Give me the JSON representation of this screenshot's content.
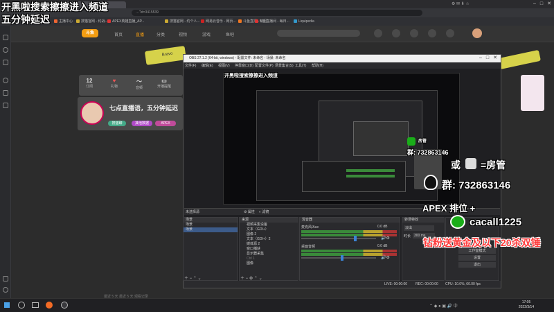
{
  "browser": {
    "tab_title": "直播...",
    "url": "…?d=3415539",
    "bookmarks": [
      "主播中心",
      "搜猫官网 - 约战...",
      "APEX英雄直播_AP...",
      "搜猫官网 - 约个人...",
      "网易云音乐 - 网页...",
      "斗鱼直播 - 热门...",
      "5 鱼直播间 - 每日...",
      "Liquipedia"
    ]
  },
  "site": {
    "nav_items": [
      "首页",
      "直播",
      "分类",
      "视频",
      "游戏",
      "鱼吧"
    ],
    "stats": [
      {
        "value": "12",
        "label": "订阅"
      },
      {
        "value": "",
        "label": "礼物"
      },
      {
        "value": "",
        "label": "音频"
      },
      {
        "value": "",
        "label": "开播提醒"
      }
    ],
    "stream_title": "七点直播语，五分钟延迟",
    "stream_pills": [
      "搜猫聊",
      "其他数据",
      "APEX"
    ],
    "bottom_text": "最近 5 天 最近 5 天 观看记录"
  },
  "obs": {
    "title": "OBS 27.1.2 (64-bit, windows) - 配置文件: 未命名 - 场景: 未命名",
    "menu": [
      "文件(F)",
      "编辑(E)",
      "视图(V)",
      "停靠窗口(D)",
      "配置文件(P)",
      "场景集合(S)",
      "工具(T)",
      "帮助(H)"
    ],
    "preview_overlay": "开黑啦搜索擦擦进入频道",
    "scenes_header": "场景",
    "scenes": [
      "场景",
      "场景"
    ],
    "sources_header": "来源",
    "sources": [
      "视频采集设备",
      "文本（GDI+）",
      "图像 2",
      "文本（GDI+）2",
      "媒体源 2",
      "窗口捕获",
      "显示器采集",
      "Ctrl 1",
      "图像"
    ],
    "mixer_header": "混音器",
    "mixer_tracks": [
      {
        "name": "麦克风/Aux",
        "db": "0.0 dB",
        "level": 0.72
      },
      {
        "name": "桌面音频",
        "db": "0.0 dB",
        "level": 0.55
      }
    ],
    "transitions_header": "转场特效",
    "transition_value": "淡出",
    "duration_label": "时长",
    "duration_value": "300 ms",
    "controls": [
      "工作室模式",
      "设置",
      "退出"
    ],
    "tabs": [
      "属性",
      "滤镜"
    ],
    "no_source": "未选择源",
    "status": {
      "live": "LIVE: 00:00:00",
      "rec": "REC: 00:00:00",
      "cpu": "CPU: 10.0%, 60.00 fps"
    }
  },
  "overlay": {
    "top_line1": "开黑啦搜索擦擦进入频道",
    "top_line2": "五分钟延迟",
    "or_text": "或",
    "fan_manager": "=房管",
    "qq_group": "群: 732863146",
    "apex_rank": "APEX 排位 +",
    "wechat": "cacall1225",
    "gift_note": "钻粉送黄金及以下20杀双锤",
    "small_group": "群: 732863146",
    "small_manager": "房管"
  },
  "stickers": {
    "top_sticker": "Bravo"
  },
  "taskbar": {
    "time": "17:05",
    "date": "2022/3/14"
  }
}
